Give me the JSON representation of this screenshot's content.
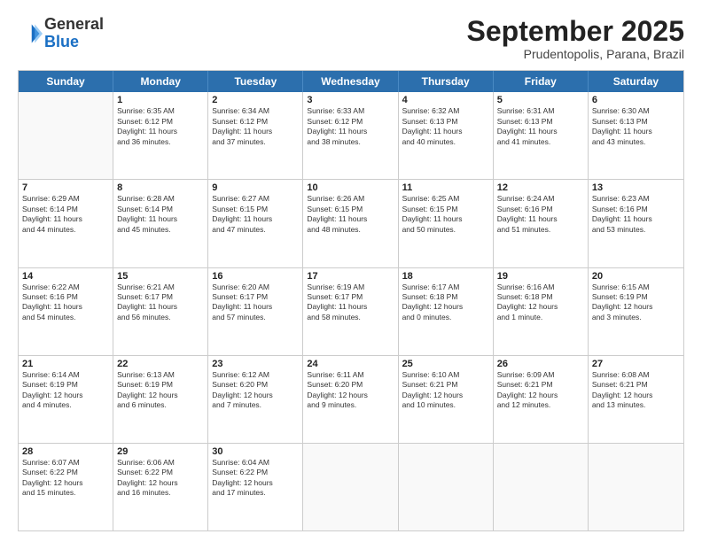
{
  "header": {
    "logo_general": "General",
    "logo_blue": "Blue",
    "month_title": "September 2025",
    "subtitle": "Prudentopolis, Parana, Brazil"
  },
  "weekdays": [
    "Sunday",
    "Monday",
    "Tuesday",
    "Wednesday",
    "Thursday",
    "Friday",
    "Saturday"
  ],
  "weeks": [
    [
      {
        "day": "",
        "info": ""
      },
      {
        "day": "1",
        "info": "Sunrise: 6:35 AM\nSunset: 6:12 PM\nDaylight: 11 hours\nand 36 minutes."
      },
      {
        "day": "2",
        "info": "Sunrise: 6:34 AM\nSunset: 6:12 PM\nDaylight: 11 hours\nand 37 minutes."
      },
      {
        "day": "3",
        "info": "Sunrise: 6:33 AM\nSunset: 6:12 PM\nDaylight: 11 hours\nand 38 minutes."
      },
      {
        "day": "4",
        "info": "Sunrise: 6:32 AM\nSunset: 6:13 PM\nDaylight: 11 hours\nand 40 minutes."
      },
      {
        "day": "5",
        "info": "Sunrise: 6:31 AM\nSunset: 6:13 PM\nDaylight: 11 hours\nand 41 minutes."
      },
      {
        "day": "6",
        "info": "Sunrise: 6:30 AM\nSunset: 6:13 PM\nDaylight: 11 hours\nand 43 minutes."
      }
    ],
    [
      {
        "day": "7",
        "info": "Sunrise: 6:29 AM\nSunset: 6:14 PM\nDaylight: 11 hours\nand 44 minutes."
      },
      {
        "day": "8",
        "info": "Sunrise: 6:28 AM\nSunset: 6:14 PM\nDaylight: 11 hours\nand 45 minutes."
      },
      {
        "day": "9",
        "info": "Sunrise: 6:27 AM\nSunset: 6:15 PM\nDaylight: 11 hours\nand 47 minutes."
      },
      {
        "day": "10",
        "info": "Sunrise: 6:26 AM\nSunset: 6:15 PM\nDaylight: 11 hours\nand 48 minutes."
      },
      {
        "day": "11",
        "info": "Sunrise: 6:25 AM\nSunset: 6:15 PM\nDaylight: 11 hours\nand 50 minutes."
      },
      {
        "day": "12",
        "info": "Sunrise: 6:24 AM\nSunset: 6:16 PM\nDaylight: 11 hours\nand 51 minutes."
      },
      {
        "day": "13",
        "info": "Sunrise: 6:23 AM\nSunset: 6:16 PM\nDaylight: 11 hours\nand 53 minutes."
      }
    ],
    [
      {
        "day": "14",
        "info": "Sunrise: 6:22 AM\nSunset: 6:16 PM\nDaylight: 11 hours\nand 54 minutes."
      },
      {
        "day": "15",
        "info": "Sunrise: 6:21 AM\nSunset: 6:17 PM\nDaylight: 11 hours\nand 56 minutes."
      },
      {
        "day": "16",
        "info": "Sunrise: 6:20 AM\nSunset: 6:17 PM\nDaylight: 11 hours\nand 57 minutes."
      },
      {
        "day": "17",
        "info": "Sunrise: 6:19 AM\nSunset: 6:17 PM\nDaylight: 11 hours\nand 58 minutes."
      },
      {
        "day": "18",
        "info": "Sunrise: 6:17 AM\nSunset: 6:18 PM\nDaylight: 12 hours\nand 0 minutes."
      },
      {
        "day": "19",
        "info": "Sunrise: 6:16 AM\nSunset: 6:18 PM\nDaylight: 12 hours\nand 1 minute."
      },
      {
        "day": "20",
        "info": "Sunrise: 6:15 AM\nSunset: 6:19 PM\nDaylight: 12 hours\nand 3 minutes."
      }
    ],
    [
      {
        "day": "21",
        "info": "Sunrise: 6:14 AM\nSunset: 6:19 PM\nDaylight: 12 hours\nand 4 minutes."
      },
      {
        "day": "22",
        "info": "Sunrise: 6:13 AM\nSunset: 6:19 PM\nDaylight: 12 hours\nand 6 minutes."
      },
      {
        "day": "23",
        "info": "Sunrise: 6:12 AM\nSunset: 6:20 PM\nDaylight: 12 hours\nand 7 minutes."
      },
      {
        "day": "24",
        "info": "Sunrise: 6:11 AM\nSunset: 6:20 PM\nDaylight: 12 hours\nand 9 minutes."
      },
      {
        "day": "25",
        "info": "Sunrise: 6:10 AM\nSunset: 6:21 PM\nDaylight: 12 hours\nand 10 minutes."
      },
      {
        "day": "26",
        "info": "Sunrise: 6:09 AM\nSunset: 6:21 PM\nDaylight: 12 hours\nand 12 minutes."
      },
      {
        "day": "27",
        "info": "Sunrise: 6:08 AM\nSunset: 6:21 PM\nDaylight: 12 hours\nand 13 minutes."
      }
    ],
    [
      {
        "day": "28",
        "info": "Sunrise: 6:07 AM\nSunset: 6:22 PM\nDaylight: 12 hours\nand 15 minutes."
      },
      {
        "day": "29",
        "info": "Sunrise: 6:06 AM\nSunset: 6:22 PM\nDaylight: 12 hours\nand 16 minutes."
      },
      {
        "day": "30",
        "info": "Sunrise: 6:04 AM\nSunset: 6:22 PM\nDaylight: 12 hours\nand 17 minutes."
      },
      {
        "day": "",
        "info": ""
      },
      {
        "day": "",
        "info": ""
      },
      {
        "day": "",
        "info": ""
      },
      {
        "day": "",
        "info": ""
      }
    ]
  ]
}
